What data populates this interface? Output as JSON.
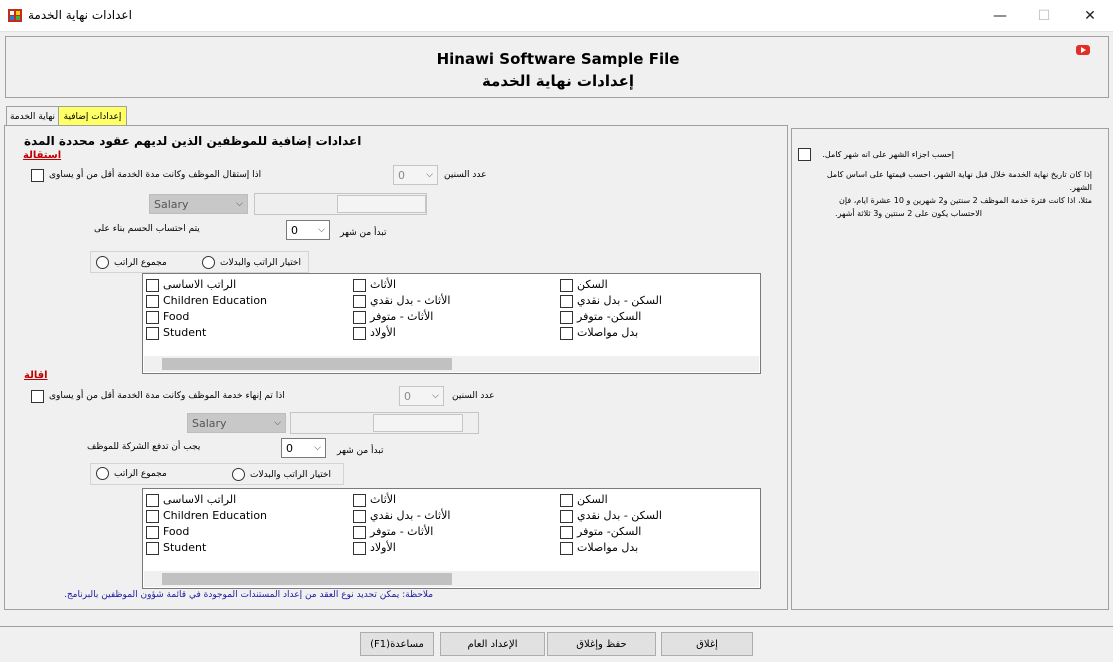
{
  "window": {
    "title": "اعدادات نهاية الخدمة",
    "minimize": "—",
    "maximize": "☐",
    "close": "✕"
  },
  "header": {
    "title": "Hinawi Software Sample File",
    "subtitle": "إعدادات نهاية الخدمة"
  },
  "tabs": [
    {
      "label": "نهاية الخدمة"
    },
    {
      "label": "إعدادات إضافية",
      "active": true
    }
  ],
  "section_title": "اعدادات إضافية للموظفين الذين لديهم عقود محددة المدة",
  "resignation": {
    "label": "استقالة",
    "condition_label": "اذا إستقال الموظف وكانت مدة الخدمة أقل من أو يساوى",
    "years_label": "عدد السنين",
    "years_value": "0",
    "salary_value": "Salary",
    "calc_label": "يتم احتساب الحسم بناء على",
    "from_month_label": "تبدأ من شهر",
    "from_month_value": "0",
    "radio_total": "مجموع الراتب",
    "radio_choose": "اختيار الراتب والبدلات"
  },
  "dismissal": {
    "label": "اقالة",
    "condition_label": "اذا تم إنهاء خدمة الموظف وكانت مدة الخدمة أقل من أو يساوى",
    "years_label": "عدد السنين",
    "years_value": "0",
    "salary_value": "Salary",
    "calc_label": "يجب أن تدفع الشركة للموظف",
    "from_month_label": "تبدأ من شهر",
    "from_month_value": "0",
    "radio_total": "مجموع الراتب",
    "radio_choose": "اختيار الراتب والبدلات"
  },
  "items": [
    "الراتب الاساسى",
    "Children Education",
    "Food",
    "Student",
    "الأثاث",
    "الأثاث - بدل نقدي",
    "الأثاث - متوفر",
    "الأولاد",
    "السكن",
    "السكن - بدل نقدي",
    "السكن- متوفر",
    "بدل مواصلات"
  ],
  "note": "ملاحظة: يمكن تحديد نوع العقد من إعداد المستندات الموجودة في قائمة شؤون الموظفين بالبرنامج.",
  "right_panel": {
    "checkbox_label": "إحسب اجزاء الشهر على انه شهر كامل.",
    "description_line1": "إذا كان تاريخ نهاية الخدمة خلال قبل نهاية الشهر، احسب قيمتها على اساس كامل الشهر.",
    "description_line2": "مثلا، اذا كانت فترة خدمة الموظف 2 سنتين و2 شهرين و 10 عشرة ايام، فإن",
    "description_line3": "الاحتساب يكون على 2 سنتين و3 ثلاثة أشهر."
  },
  "buttons": {
    "help": "(F1)مساعدة",
    "general_setup": "الإعداد العام",
    "save_close": "حفظ وإغلاق",
    "close": "إغلاق"
  }
}
